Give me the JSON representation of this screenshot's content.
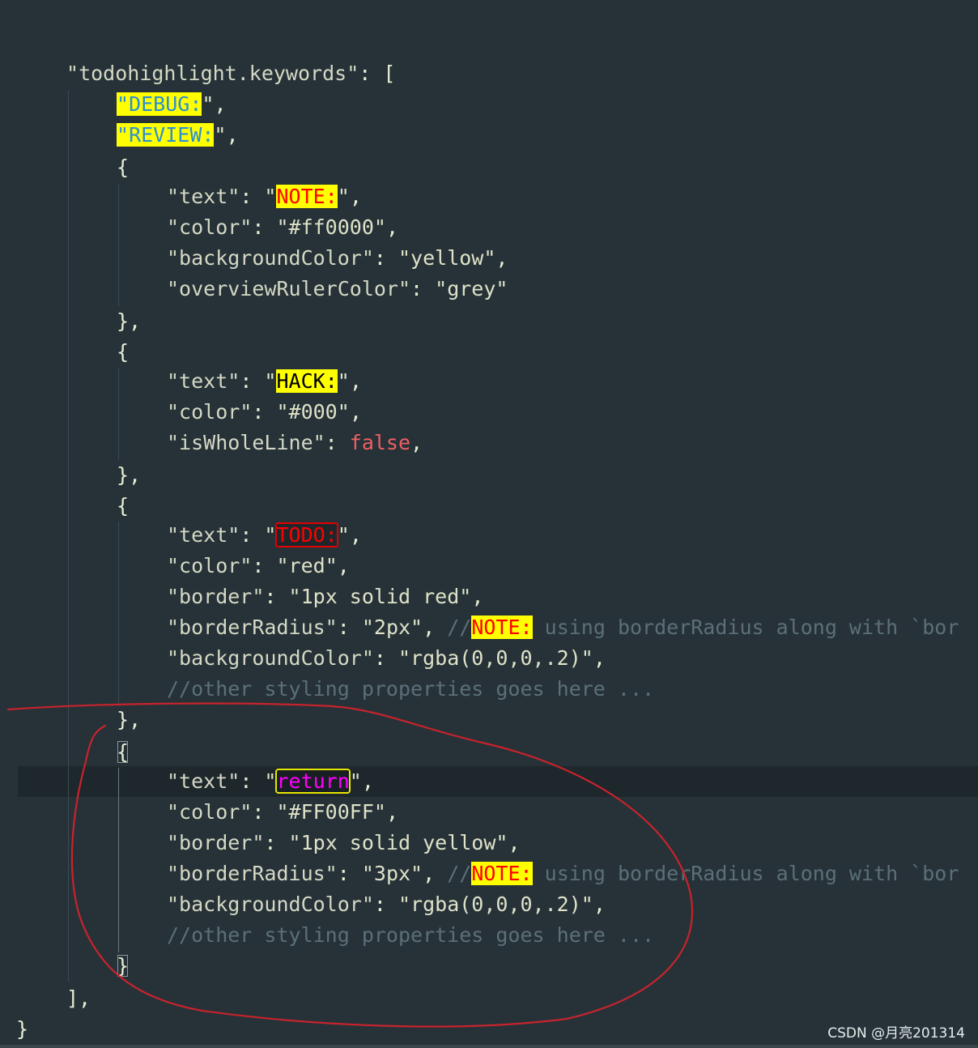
{
  "setting_key": "todohighlight.keywords",
  "keywords": [
    "DEBUG:",
    "REVIEW:"
  ],
  "objects": [
    {
      "text": "NOTE:",
      "color": "#ff0000",
      "backgroundColor": "yellow",
      "overviewRulerColor": "grey"
    },
    {
      "text": "HACK:",
      "color": "#000",
      "isWholeLine": "false"
    },
    {
      "text": "TODO:",
      "color": "red",
      "border": "1px solid red",
      "borderRadius": "2px",
      "backgroundColor": "rgba(0,0,0,.2)",
      "comment_tag": "NOTE:",
      "comment_rest": " using borderRadius along with `bor",
      "comment_line": "//other styling properties goes here ..."
    },
    {
      "text": "return",
      "color": "#FF00FF",
      "border": "1px solid yellow",
      "borderRadius": "3px",
      "backgroundColor": "rgba(0,0,0,.2)",
      "comment_tag": "NOTE:",
      "comment_rest": " using borderRadius along with `bor",
      "comment_line": "//other styling properties goes here ..."
    }
  ],
  "labels": {
    "text": "\"text\"",
    "color": "\"color\"",
    "backgroundColor": "\"backgroundColor\"",
    "overviewRulerColor": "\"overviewRulerColor\"",
    "isWholeLine": "\"isWholeLine\"",
    "border": "\"border\"",
    "borderRadius": "\"borderRadius\""
  },
  "watermark": "CSDN @月亮201314",
  "colors": {
    "editor_bg": "#263238",
    "highlight_yellow": "#ffff00",
    "annotation_red": "#c8232c",
    "return_color": "#FF00FF"
  }
}
